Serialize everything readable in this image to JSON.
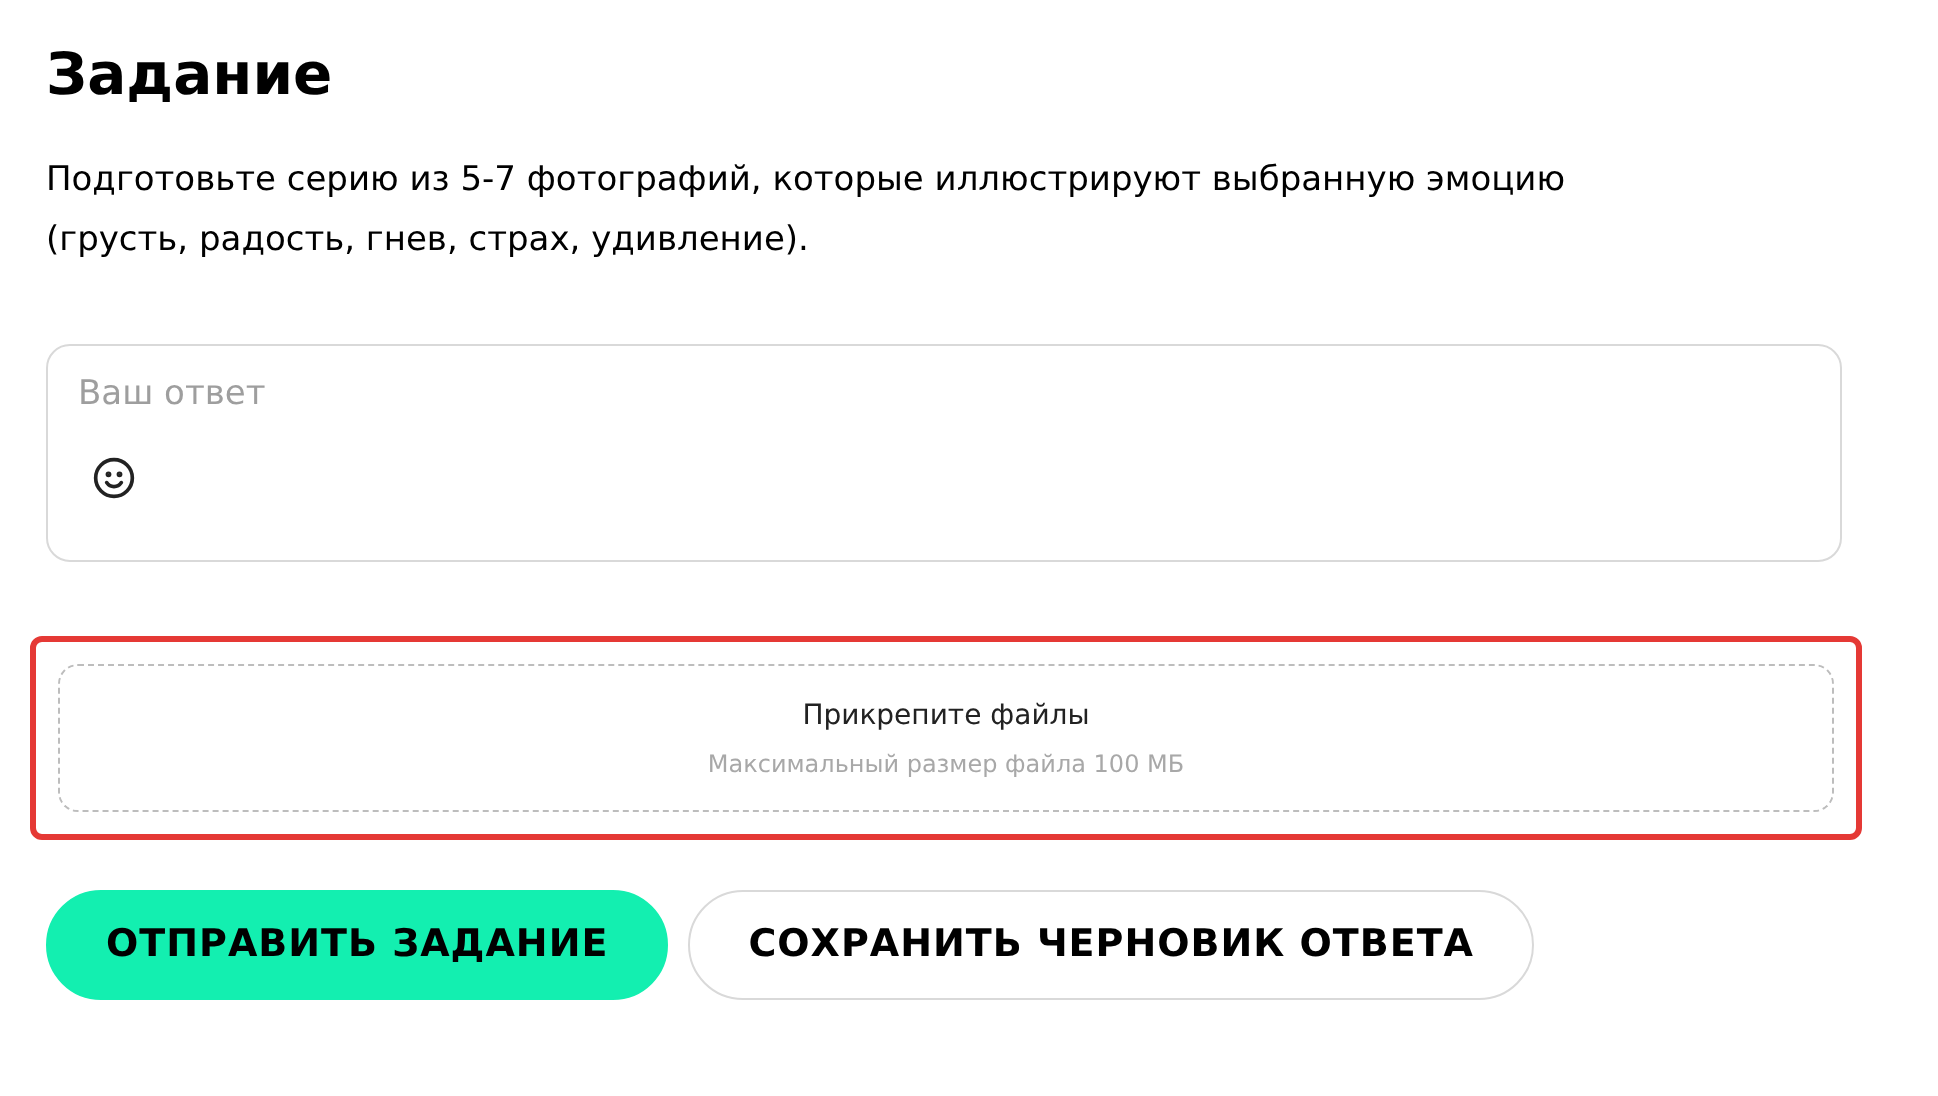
{
  "title": "Задание",
  "description": "Подготовьте серию из 5-7 фотографий, которые иллюстрируют выбранную эмоцию (грусть, радость, гнев, страх, удивление).",
  "answer": {
    "placeholder": "Ваш ответ"
  },
  "upload": {
    "label": "Прикрепите файлы",
    "hint": "Максимальный размер файла 100 МБ",
    "highlighted": true
  },
  "buttons": [
    {
      "label": "ОТПРАВИТЬ ЗАДАНИЕ",
      "kind": "primary"
    },
    {
      "label": "СОХРАНИТЬ ЧЕРНОВИК ОТВЕТА",
      "kind": "secondary"
    }
  ]
}
